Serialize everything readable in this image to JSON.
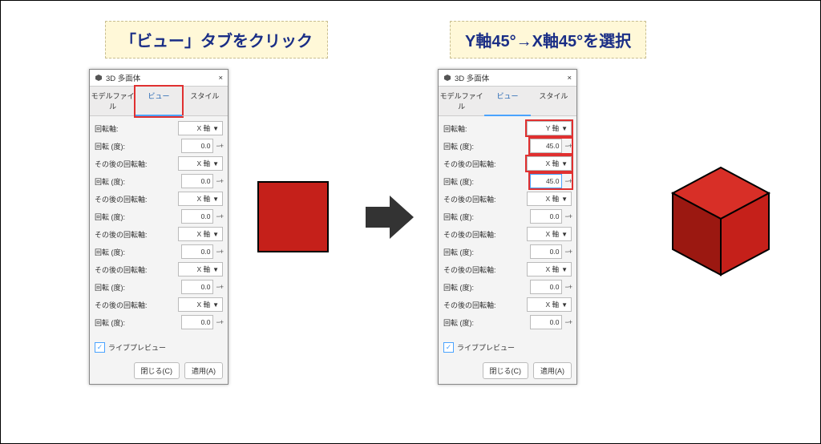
{
  "callout1": "「ビュー」タブをクリック",
  "callout2": "Y軸45°→X軸45°を選択",
  "panel": {
    "title": "3D 多面体",
    "close": "×",
    "tabs": {
      "model": "モデルファイル",
      "view": "ビュー",
      "style": "スタイル"
    },
    "labels": {
      "axis0": "回転軸:",
      "axisN": "その後の回転軸:",
      "deg": "回転 (度):"
    },
    "axisX": "X 軸",
    "axisY": "Y 軸",
    "v0": "0.0",
    "v45": "45.0",
    "live": "ライブプレビュー",
    "closeBtn": "閉じる(C)",
    "applyBtn": "適用(A)"
  }
}
